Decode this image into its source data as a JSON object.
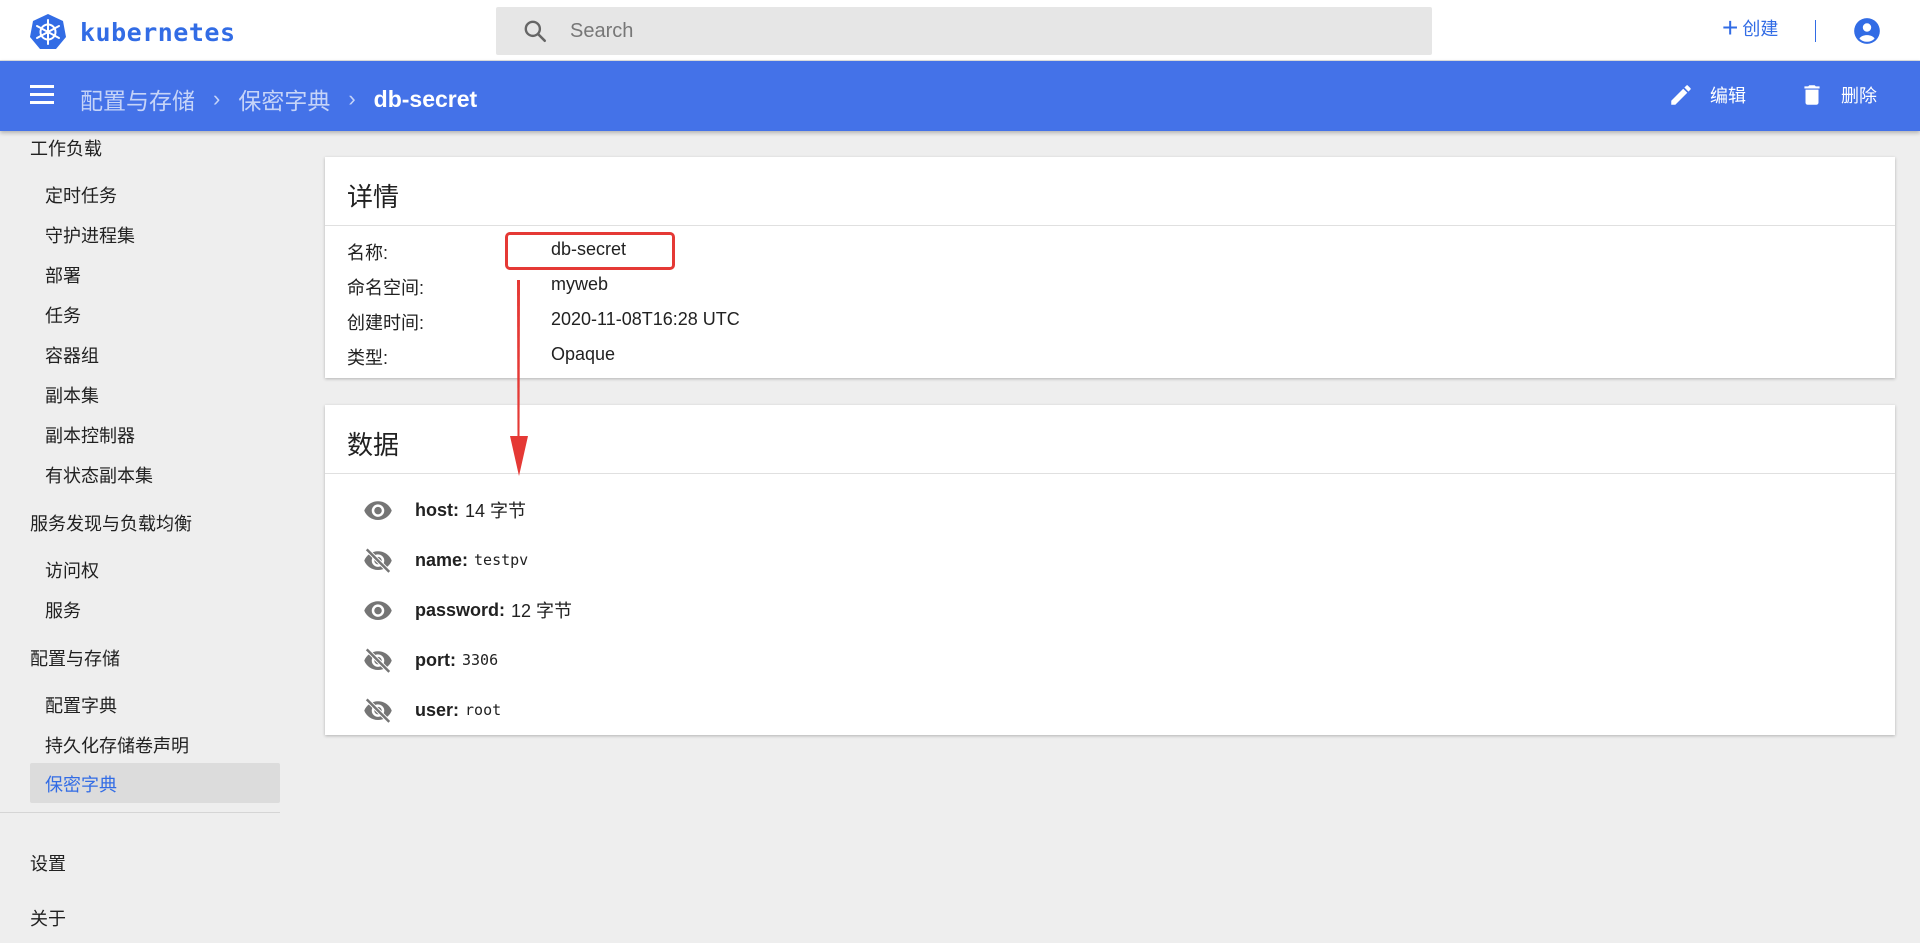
{
  "header": {
    "app_name": "kubernetes",
    "logo_icon": "kubernetes-helm-icon",
    "search_placeholder": "Search",
    "create_label": "创建",
    "accent_color": "#326ce5"
  },
  "actionbar": {
    "background": "#4472e8",
    "breadcrumbs": [
      "配置与存储",
      "保密字典"
    ],
    "current": "db-secret",
    "edit_label": "编辑",
    "delete_label": "删除"
  },
  "sidebar": {
    "sections": [
      {
        "title": "工作负载",
        "items": [
          "定时任务",
          "守护进程集",
          "部署",
          "任务",
          "容器组",
          "副本集",
          "副本控制器",
          "有状态副本集"
        ]
      },
      {
        "title": "服务发现与负载均衡",
        "items": [
          "访问权",
          "服务"
        ]
      },
      {
        "title": "配置与存储",
        "items": [
          "配置字典",
          "持久化存储卷声明",
          "保密字典"
        ]
      }
    ],
    "active_item": "保密字典",
    "footer": [
      "设置",
      "关于"
    ]
  },
  "details": {
    "title": "详情",
    "rows": [
      {
        "label": "名称:",
        "value": "db-secret"
      },
      {
        "label": "命名空间:",
        "value": "myweb"
      },
      {
        "label": "创建时间:",
        "value": "2020-11-08T16:28 UTC"
      },
      {
        "label": "类型:",
        "value": "Opaque"
      }
    ]
  },
  "data": {
    "title": "数据",
    "rows": [
      {
        "key": "host:",
        "value": "14 字节",
        "icon": "eye-icon",
        "revealed": false
      },
      {
        "key": "name:",
        "value": "testpv",
        "icon": "eye-off-icon",
        "revealed": true
      },
      {
        "key": "password:",
        "value": "12 字节",
        "icon": "eye-icon",
        "revealed": false
      },
      {
        "key": "port:",
        "value": "3306",
        "icon": "eye-off-icon",
        "revealed": true
      },
      {
        "key": "user:",
        "value": "root",
        "icon": "eye-off-icon",
        "revealed": true
      }
    ]
  },
  "annotation": {
    "color": "#e53935"
  }
}
